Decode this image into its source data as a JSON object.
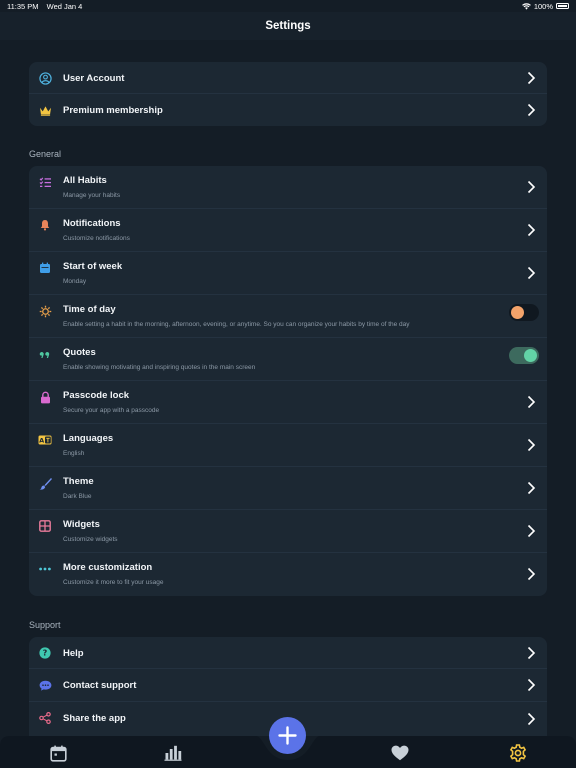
{
  "status": {
    "time": "11:35 PM",
    "date": "Wed Jan 4",
    "battery": "100%"
  },
  "header": {
    "title": "Settings"
  },
  "account": [
    {
      "title": "User Account",
      "icon": "user-circle-icon",
      "color": "#4fb3e0"
    },
    {
      "title": "Premium membership",
      "icon": "crown-icon",
      "color": "#f3c542"
    }
  ],
  "general": {
    "label": "General",
    "items": [
      {
        "title": "All Habits",
        "subtitle": "Manage your habits",
        "icon": "list-check-icon",
        "color": "#c86fe0",
        "control": "chevron"
      },
      {
        "title": "Notifications",
        "subtitle": "Customize notifications",
        "icon": "bell-icon",
        "color": "#e8845a",
        "control": "chevron"
      },
      {
        "title": "Start of week",
        "subtitle": "Monday",
        "icon": "calendar-icon",
        "color": "#3f9ee8",
        "control": "chevron"
      },
      {
        "title": "Time of day",
        "subtitle": "Enable setting a habit in the morning, afternoon, evening, or anytime. So you can organize your habits by time of the day",
        "icon": "sun-gear-icon",
        "color": "#e8a04a",
        "control": "toggle",
        "on": false
      },
      {
        "title": "Quotes",
        "subtitle": "Enable showing motivating and inspiring quotes in the main screen",
        "icon": "quote-icon",
        "color": "#4fc8a0",
        "control": "toggle",
        "on": true
      },
      {
        "title": "Passcode lock",
        "subtitle": "Secure your app with a passcode",
        "icon": "lock-icon",
        "color": "#d96ad0",
        "control": "chevron"
      },
      {
        "title": "Languages",
        "subtitle": "English",
        "icon": "language-icon",
        "color": "#f3c542",
        "control": "chevron"
      },
      {
        "title": "Theme",
        "subtitle": "Dark Blue",
        "icon": "brush-icon",
        "color": "#6f8ff0",
        "control": "chevron"
      },
      {
        "title": "Widgets",
        "subtitle": "Customize widgets",
        "icon": "widgets-icon",
        "color": "#e87a9a",
        "control": "chevron"
      },
      {
        "title": "More customization",
        "subtitle": "Customize it more to fit your usage",
        "icon": "more-dots-icon",
        "color": "#4fc8d8",
        "control": "chevron"
      }
    ]
  },
  "support": {
    "label": "Support",
    "items": [
      {
        "title": "Help",
        "icon": "help-icon",
        "color": "#3fc8b0"
      },
      {
        "title": "Contact support",
        "icon": "chat-icon",
        "color": "#5b73e8"
      },
      {
        "title": "Share the app",
        "icon": "share-icon",
        "color": "#e86a8a"
      }
    ]
  },
  "tabbar": {
    "tabs": [
      {
        "name": "calendar-tab-icon",
        "active": false
      },
      {
        "name": "stats-tab-icon",
        "active": false
      },
      {
        "name": "heart-tab-icon",
        "active": false
      },
      {
        "name": "settings-tab-icon",
        "active": true
      }
    ],
    "fab_icon": "plus-icon",
    "active_color": "#f3c542",
    "inactive_color": "#c8d0d8"
  }
}
